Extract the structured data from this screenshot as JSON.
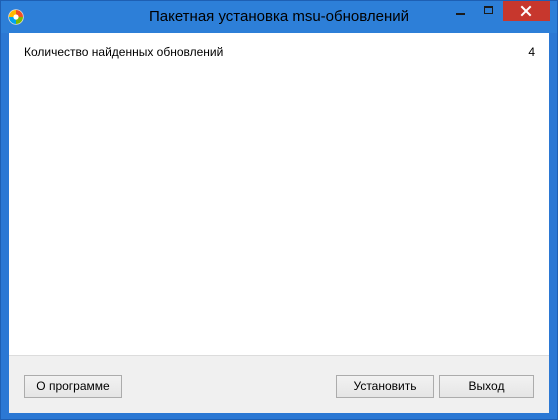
{
  "window": {
    "title": "Пакетная установка msu-обновлений",
    "title_bar_color": "#2d7fd8",
    "close_button_color": "#c7372d"
  },
  "main": {
    "count_label": "Количество найденных обновлений",
    "count_value": "4"
  },
  "footer": {
    "about_label": "О программе",
    "install_label": "Установить",
    "exit_label": "Выход"
  },
  "icons": {
    "app": "app-icon",
    "minimize": "minimize-icon",
    "maximize": "maximize-icon",
    "close": "close-icon"
  }
}
